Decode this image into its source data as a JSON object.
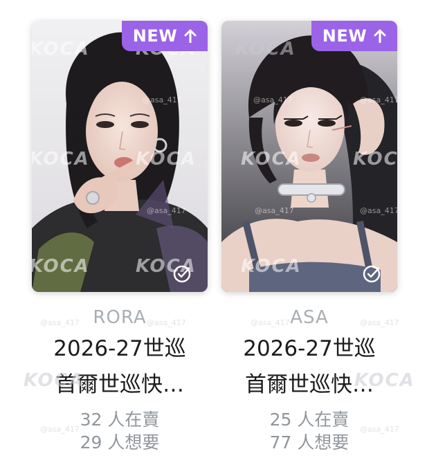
{
  "cards": [
    {
      "badge_label": "NEW",
      "member": "RORA",
      "title_line1": "2026-27世巡",
      "title_line2": "首爾世巡快…",
      "sellers": "32 人在賣",
      "wanters": "29 人想要"
    },
    {
      "badge_label": "NEW",
      "member": "ASA",
      "title_line1": "2026-27世巡",
      "title_line2": "首爾世巡快…",
      "sellers": "25 人在賣",
      "wanters": "77 人想要"
    }
  ],
  "watermark": {
    "brand": "KOCA",
    "handle": "@asa_417"
  },
  "colors": {
    "badge": "#9b63e8",
    "member_text": "#a9aeb3",
    "title_text": "#1c1c1c",
    "stat_text": "#8f969c"
  }
}
